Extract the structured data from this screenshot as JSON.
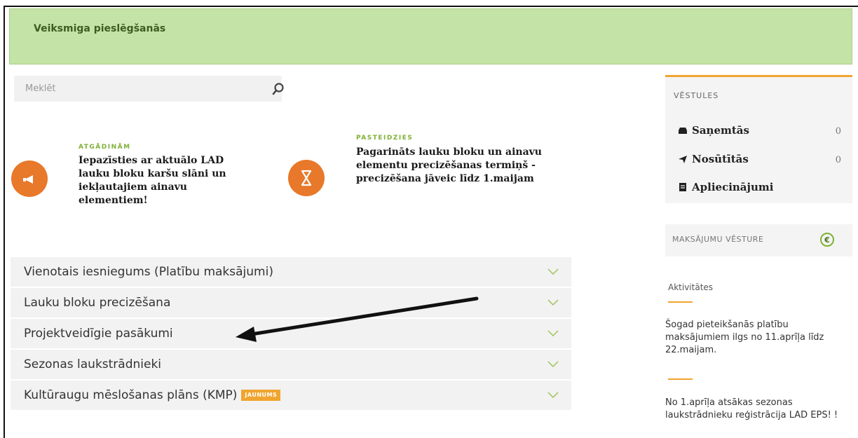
{
  "banner": {
    "message": "Veiksmiga pieslēgšanās"
  },
  "search": {
    "placeholder": "Meklēt"
  },
  "notices": [
    {
      "tag": "ATGĀDINĀM",
      "title": "Iepazīsties ar aktuālo LAD lauku bloku karšu slāni un iekļautajiem ainavu elementiem!",
      "icon": "megaphone-icon"
    },
    {
      "tag": "PASTEIDZIES",
      "title": "Pagarināts lauku bloku un ainavu elementu precizēšanas termiņš - precizēšana jāveic līdz 1.maijam",
      "icon": "hourglass-icon"
    }
  ],
  "accordion": [
    {
      "label": "Vienotais iesniegums (Platību maksājumi)"
    },
    {
      "label": "Lauku bloku precizēšana"
    },
    {
      "label": "Projektveidīgie pasākumi"
    },
    {
      "label": "Sezonas laukstrādnieki"
    },
    {
      "label": "Kultūraugu mēslošanas plāns (KMP)",
      "badge": "JAUNUMS"
    }
  ],
  "letters": {
    "heading": "VĒSTULES",
    "items": [
      {
        "label": "Saņemtās",
        "count": "0",
        "icon": "inbox-icon"
      },
      {
        "label": "Nosūtītās",
        "count": "0",
        "icon": "send-icon"
      },
      {
        "label": "Apliecinājumi",
        "icon": "certificate-icon"
      }
    ]
  },
  "payments": {
    "heading": "MAKSĀJUMU VĒSTURE",
    "icon": "euro-icon",
    "symbol": "€"
  },
  "activities": {
    "heading": "Aktivitātes",
    "items": [
      "Šogad pieteikšanās platību maksājumiem ilgs no 11.aprīļa līdz 22.maijam.",
      "No 1.aprīļa atsākas sezonas laukstrādnieku reģistrācija LAD EPS! !"
    ]
  },
  "colors": {
    "accent_orange": "#e8782a",
    "success_green": "#c4e3a6",
    "tag_green": "#7fb135",
    "badge_orange": "#f0a530"
  }
}
